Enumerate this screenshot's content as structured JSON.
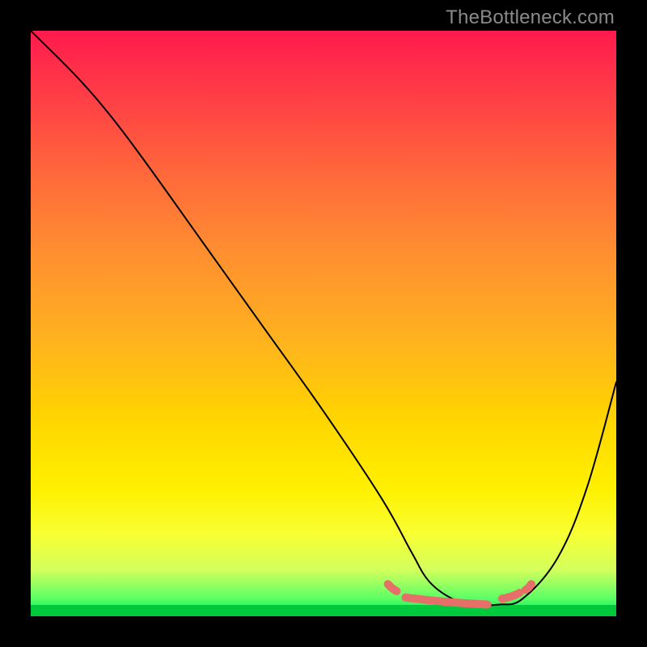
{
  "watermark": "TheBottleneck.com",
  "chart_data": {
    "type": "line",
    "title": "",
    "xlabel": "",
    "ylabel": "",
    "xlim": [
      0,
      100
    ],
    "ylim": [
      0,
      100
    ],
    "grid": false,
    "legend": false,
    "series": [
      {
        "name": "bottleneck-curve",
        "x": [
          0,
          8,
          14,
          20,
          30,
          40,
          50,
          60,
          65,
          68,
          72,
          76,
          80,
          84,
          90,
          95,
          100
        ],
        "values": [
          100,
          92,
          85,
          77,
          63,
          49,
          35,
          20,
          11,
          6,
          3,
          2,
          2,
          3,
          10,
          22,
          40
        ]
      }
    ],
    "highlight_segments": [
      {
        "name": "left-dash-1",
        "x0": 61.0,
        "y0": 5.5,
        "x1": 62.5,
        "y1": 4.3
      },
      {
        "name": "valley-floor",
        "x0": 64.0,
        "y0": 3.2,
        "x1": 78.0,
        "y1": 2.0
      },
      {
        "name": "right-dash-1",
        "x0": 80.5,
        "y0": 3.0,
        "x1": 83.5,
        "y1": 4.0
      },
      {
        "name": "right-dash-2",
        "x0": 84.5,
        "y0": 4.5,
        "x1": 85.5,
        "y1": 5.5
      }
    ],
    "colors": {
      "curve": "#000000",
      "highlight": "#e76f6a",
      "frame": "#000000",
      "gradient_top": "#ff1a4d",
      "gradient_bottom": "#00e64d"
    }
  }
}
